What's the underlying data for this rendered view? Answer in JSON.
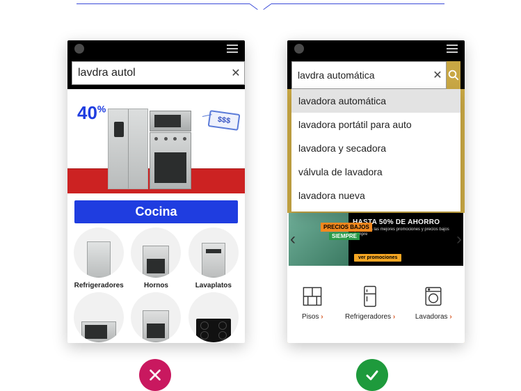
{
  "bad": {
    "search": {
      "value": "lavdra autol",
      "clear": "✕"
    },
    "hero": {
      "discount": "40",
      "discount_suffix": "%",
      "price_tag": "$$$"
    },
    "cocina_label": "Cocina",
    "tiles": [
      {
        "label": "Refrigeradores"
      },
      {
        "label": "Hornos"
      },
      {
        "label": "Lavaplatos"
      }
    ]
  },
  "good": {
    "search": {
      "value": "lavdra automática",
      "clear": "✕"
    },
    "suggestions": [
      "lavadora automática",
      "lavadora portátil para auto",
      "lavadora y secadora",
      "válvula de lavadora",
      "lavadora nueva"
    ],
    "banner": {
      "ribbon1": "PRECIOS BAJOS",
      "ribbon2": "SIEMPRE",
      "headline": "HASTA 50% DE AHORRO",
      "subline": "Aprovecha las mejores promociones y precios bajos siempre",
      "cta": "ver promociones"
    },
    "categories": [
      {
        "label": "Pisos"
      },
      {
        "label": "Refrigeradores"
      },
      {
        "label": "Lavadoras"
      }
    ]
  }
}
